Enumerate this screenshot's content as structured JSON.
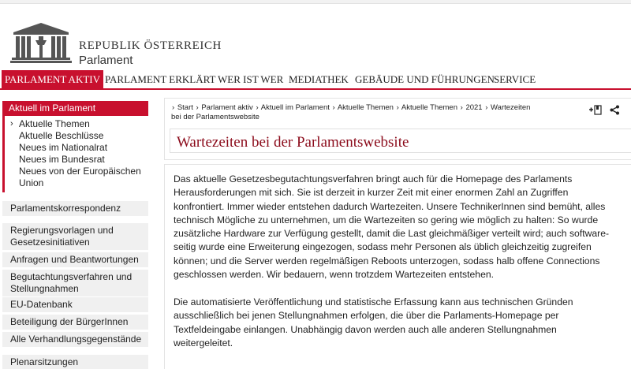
{
  "brand": {
    "line1": "REPUBLIK ÖSTERREICH",
    "line2": "Parlament"
  },
  "nav": [
    {
      "label": "PARLAMENT AKTIV"
    },
    {
      "label": "PARLAMENT ERKLÄRT"
    },
    {
      "label": "WER IST WER"
    },
    {
      "label": "MEDIATHEK"
    },
    {
      "label": "GEBÄUDE UND FÜHRUNGEN"
    },
    {
      "label": "SERVICE"
    }
  ],
  "sidebar": {
    "active_section": "Aktuell im Parlament",
    "sub_items": [
      {
        "label": "Aktuelle Themen"
      },
      {
        "label": "Aktuelle Beschlüsse"
      },
      {
        "label": "Neues im Nationalrat"
      },
      {
        "label": "Neues im Bundesrat"
      },
      {
        "label": "Neues von der Europäischen Union"
      }
    ],
    "items": [
      {
        "label": "Parlamentskorrespondenz"
      },
      {
        "label": "Regierungsvorlagen und Gesetzesinitiativen"
      },
      {
        "label": "Anfragen und Beantwortungen"
      },
      {
        "label": "Begutachtungsverfahren und Stellungnahmen"
      },
      {
        "label": "EU-Datenbank"
      },
      {
        "label": "Beteiligung der BürgerInnen"
      },
      {
        "label": "Alle Verhandlungsgegenstände"
      },
      {
        "label": "Plenarsitzungen"
      }
    ]
  },
  "breadcrumb": [
    {
      "label": "Start"
    },
    {
      "label": "Parlament aktiv"
    },
    {
      "label": "Aktuell im Parlament"
    },
    {
      "label": "Aktuelle Themen"
    },
    {
      "label": "Aktuelle Themen"
    },
    {
      "label": "2021"
    },
    {
      "label": "Wartezeiten bei der Parlamentswebsite"
    }
  ],
  "tools": {
    "bookmark_icon": "+⎘",
    "share_icon": "share"
  },
  "page": {
    "title": "Wartezeiten bei der Parlamentswebsite",
    "paragraph1": "Das aktuelle Gesetzesbegutachtungsverfahren bringt auch für die Homepage des Parlaments Herausforderungen mit sich. Sie ist derzeit in kurzer Zeit mit einer enormen Zahl an Zugriffen konfrontiert. Immer wieder entstehen dadurch Wartezeiten. Unsere TechnikerInnen sind bemüht, alles technisch Mögliche zu unternehmen, um die Wartezeiten so gering wie möglich zu halten: So wurde zusätzliche Hardware zur Verfügung gestellt, damit die Last gleichmäßiger verteilt wird; auch software-seitig wurde eine Erweiterung eingezogen, sodass mehr Personen als üblich gleichzeitig zugreifen können; und die Server werden regelmäßigen Reboots unterzogen, sodass halb offene Connections geschlossen werden. Wir bedauern, wenn trotzdem Wartezeiten entstehen.",
    "paragraph2": "Die automatisierte Veröffentlichung und statistische Erfassung kann aus technischen Gründen ausschließlich bei jenen Stellungnahmen erfolgen, die über die Parlaments-Homepage per Textfeldeingabe einlangen. Unabhängig davon werden auch alle anderen Stellungnahmen weitergeleitet."
  },
  "colors": {
    "accent": "#c8102e",
    "title": "#8b0a1a"
  }
}
